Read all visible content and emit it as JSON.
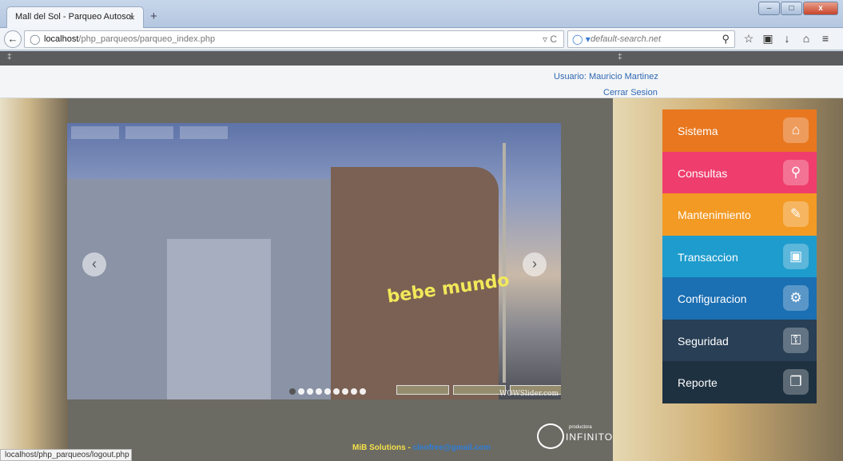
{
  "browser": {
    "tab_title": "Mall del Sol - Parqueo Autosol",
    "tab_close": "×",
    "new_tab": "+",
    "url_host": "localhost",
    "url_path": "/php_parqueos/parqueo_index.php",
    "search_placeholder": "default-search.net",
    "window_min": "–",
    "window_max": "□",
    "window_close": "x"
  },
  "header": {
    "user_label": "Usuario: Mauricio Martinez",
    "logout_link": "Cerrar Sesion"
  },
  "slider": {
    "watermark": "WOWSlider.com",
    "sign_text": "bebe mundo",
    "bullet_count": 9,
    "active_index": 0
  },
  "menu": {
    "items": [
      {
        "label": "Sistema",
        "icon": "home-icon",
        "color": "#e8771f"
      },
      {
        "label": "Consultas",
        "icon": "search-icon",
        "color": "#ef3d6d"
      },
      {
        "label": "Mantenimiento",
        "icon": "pencil-icon",
        "color": "#f39a24"
      },
      {
        "label": "Transaccion",
        "icon": "shopping-bag-icon",
        "color": "#1e9ccd"
      },
      {
        "label": "Configuracion",
        "icon": "gear-icon",
        "color": "#1b6fb3"
      },
      {
        "label": "Seguridad",
        "icon": "lock-icon",
        "color": "#283f55"
      },
      {
        "label": "Reporte",
        "icon": "copy-icon",
        "color": "#1e3141"
      }
    ]
  },
  "footer": {
    "company": "MiB Solutions",
    "separator": " - ",
    "email": "cleofree@gmail.com",
    "logo_text": "INFINITO",
    "logo_small": "productora"
  },
  "status_bar": {
    "text": "localhost/php_parqueos/logout.php"
  }
}
